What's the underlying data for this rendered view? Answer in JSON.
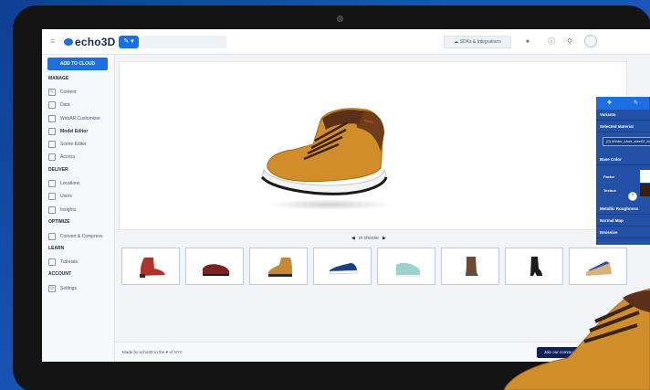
{
  "app": {
    "logo_text": "echo3D",
    "accent": "#1d6fe0"
  },
  "topbar": {
    "sdk_label": "SDKs & Integrations",
    "icons": [
      "hamburger-icon",
      "magic-wand-icon",
      "info-icon",
      "search-icon",
      "avatar"
    ]
  },
  "sidebar": {
    "add_to_cloud": "ADD TO CLOUD",
    "sections": {
      "manage": "MANAGE",
      "deliver": "DELIVER",
      "optimize": "OPTIMIZE",
      "learn": "LEARN",
      "account": "ACCOUNT"
    },
    "items": {
      "content": "Content",
      "data": "Data",
      "webar": "WebAR Customizer",
      "model_editor": "Model Editor",
      "scene_editor": "Scene Editor",
      "access": "Access",
      "locations": "Locations",
      "users": "Users",
      "insights": "Insights",
      "convert": "Convert & Compress",
      "tutorials": "Tutorials",
      "settings": "Settings"
    }
  },
  "panel": {
    "variants": "Variants",
    "selected_material": "Selected Material",
    "material_value": "(0) Winter_shoe_size02_bo",
    "base_color": "Base Color",
    "factor": "Factor",
    "texture": "Texture",
    "metallic": "Metallic Roughness",
    "normal_map": "Normal Map",
    "emissive": "Emissive"
  },
  "chooser": {
    "label": "or choose"
  },
  "footer": {
    "made_by": "Made by echo3D in the ♥ of NYC",
    "join": "Join our commun"
  },
  "thumbnails": [
    {
      "name": "red-ankle-boot",
      "color": "#b0332a"
    },
    {
      "name": "burgundy-oxford",
      "color": "#7a2224"
    },
    {
      "name": "tan-hiking-boot",
      "color": "#c78a33"
    },
    {
      "name": "blue-sneaker",
      "color": "#1f3e8a"
    },
    {
      "name": "mint-sneaker",
      "color": "#9cd3cf"
    },
    {
      "name": "brown-boot",
      "color": "#6b4a35"
    },
    {
      "name": "black-heeled-boot",
      "color": "#1c1c1c"
    },
    {
      "name": "blue-espadrille-wedge",
      "color": "#3a4fa0"
    }
  ]
}
